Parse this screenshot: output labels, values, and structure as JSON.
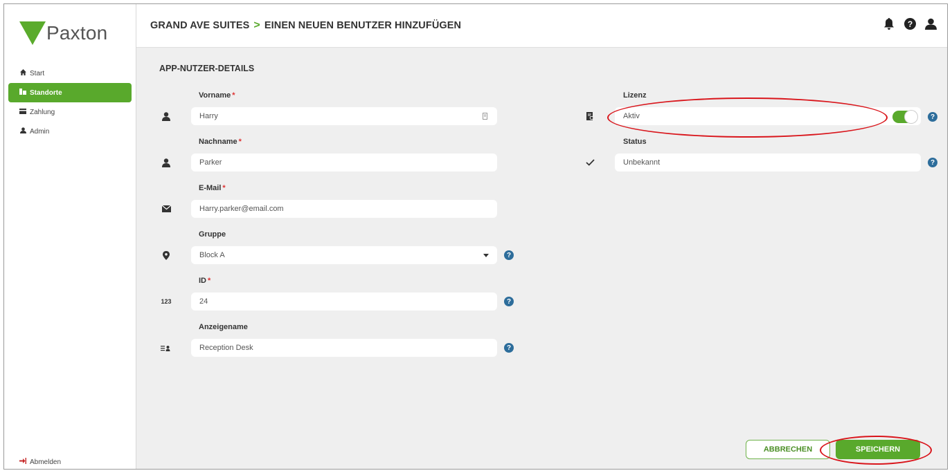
{
  "logo": {
    "text": "Paxton"
  },
  "sidebar": {
    "items": [
      {
        "label": "Start",
        "icon": "home-icon"
      },
      {
        "label": "Standorte",
        "icon": "sites-icon",
        "active": true
      },
      {
        "label": "Zahlung",
        "icon": "payment-icon"
      },
      {
        "label": "Admin",
        "icon": "user-icon"
      }
    ],
    "logout_label": "Abmelden"
  },
  "header": {
    "site": "GRAND AVE SUITES",
    "separator": ">",
    "page": "EINEN NEUEN BENUTZER HINZUFÜGEN"
  },
  "form": {
    "section_title": "APP-NUTZER-DETAILS",
    "required_mark": "*",
    "firstname": {
      "label": "Vorname",
      "value": "Harry"
    },
    "lastname": {
      "label": "Nachname",
      "value": "Parker"
    },
    "email": {
      "label": "E-Mail",
      "value": "Harry.parker@email.com"
    },
    "group": {
      "label": "Gruppe",
      "value": "Block A"
    },
    "id": {
      "label": "ID",
      "value": "24",
      "icon_text": "123"
    },
    "display_name": {
      "label": "Anzeigename",
      "value": "Reception Desk"
    },
    "license": {
      "label": "Lizenz",
      "value": "Aktiv",
      "toggle_on": true
    },
    "status": {
      "label": "Status",
      "value": "Unbekannt"
    }
  },
  "buttons": {
    "cancel": "ABBRECHEN",
    "save": "SPEICHERN"
  },
  "help_glyph": "?",
  "colors": {
    "brand_green": "#59a92c",
    "help_blue": "#2d6d9b",
    "required_red": "#d33333",
    "highlight_red": "#d9151b"
  }
}
